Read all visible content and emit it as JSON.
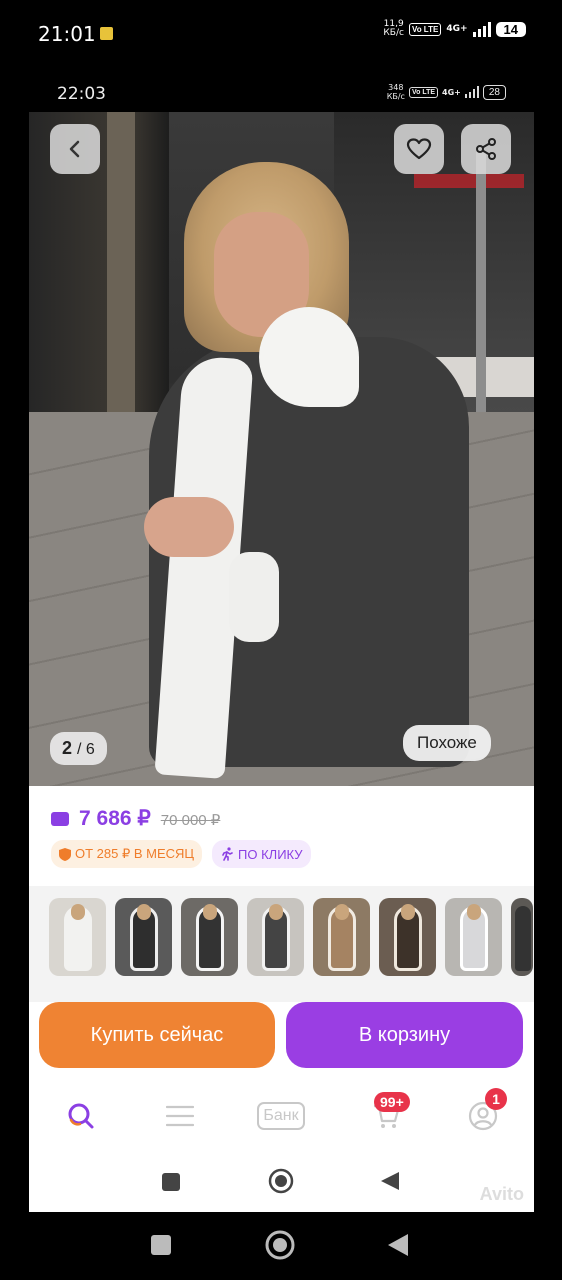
{
  "outer_status": {
    "time": "21:01",
    "speed_value": "11,9",
    "speed_unit": "КБ/с",
    "volte": "Vo LTE",
    "network": "4G+",
    "battery": "14"
  },
  "inner_status": {
    "time": "22:03",
    "speed_value": "348",
    "speed_unit": "КБ/с",
    "volte": "Vo LTE",
    "network": "4G+",
    "battery": "28"
  },
  "photo": {
    "counter_current": "2",
    "counter_total": "/ 6",
    "similar_label": "Похоже"
  },
  "pricing": {
    "price": "7 686 ₽",
    "old_price": "70 000 ₽",
    "installment_badge": "ОТ 285 ₽ В МЕСЯЦ",
    "one_click_badge": "ПО КЛИКУ"
  },
  "similar_items": [
    {
      "name": "item-1"
    },
    {
      "name": "item-2"
    },
    {
      "name": "item-3"
    },
    {
      "name": "item-4"
    },
    {
      "name": "item-5"
    },
    {
      "name": "item-6"
    },
    {
      "name": "item-7"
    },
    {
      "name": "item-8"
    }
  ],
  "actions": {
    "buy_now": "Купить сейчас",
    "add_to_cart": "В корзину"
  },
  "tabbar": {
    "bank_label": "Банк",
    "cart_count": "99+",
    "profile_count": "1"
  },
  "watermark": "Avito",
  "colors": {
    "accent_purple": "#9a3ee3",
    "accent_orange": "#ef8333",
    "badge_red": "#e8334a"
  }
}
